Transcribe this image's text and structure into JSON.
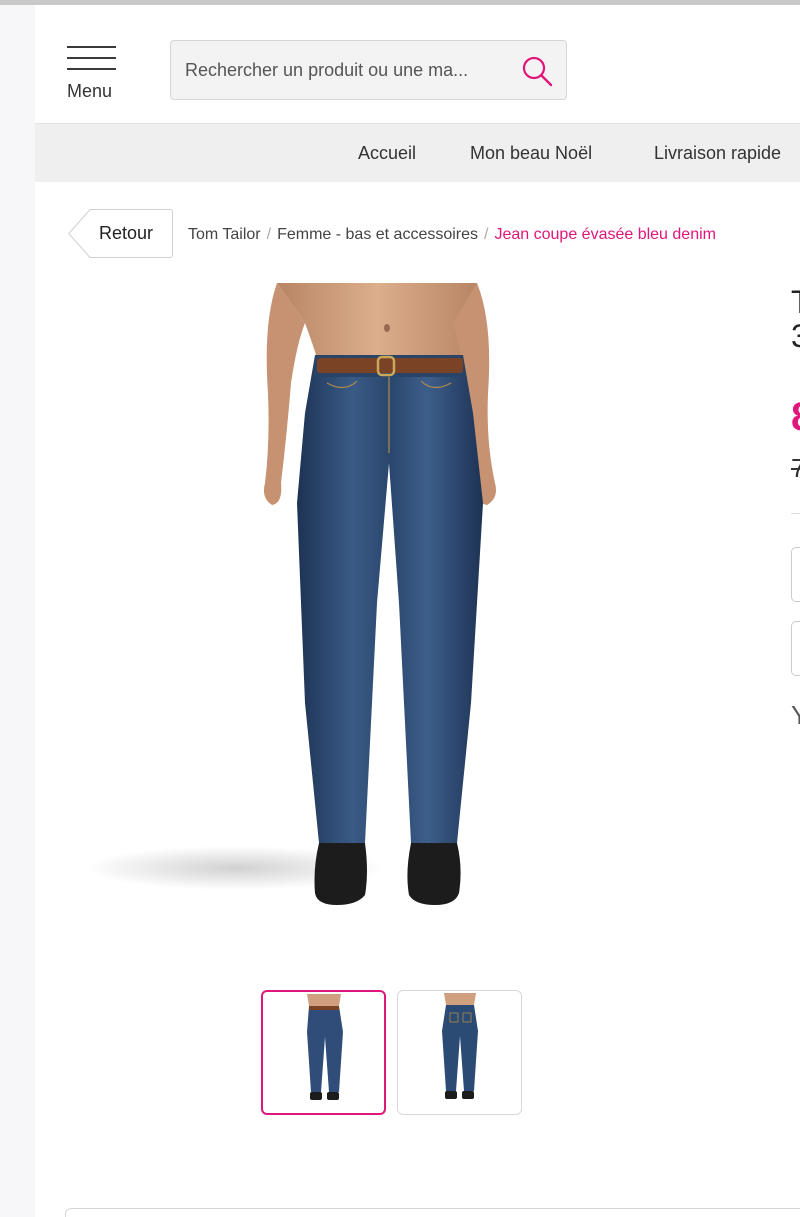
{
  "header": {
    "menu_label": "Menu",
    "search_placeholder": "Rechercher un produit ou une ma..."
  },
  "nav": {
    "items": [
      {
        "label": "Accueil"
      },
      {
        "label": "Mon beau Noël"
      },
      {
        "label": "Livraison rapide"
      }
    ]
  },
  "breadcrumb": {
    "back_label": "Retour",
    "items": [
      {
        "label": "Tom Tailor"
      },
      {
        "label": "Femme - bas et accessoires"
      }
    ],
    "current": "Jean coupe évasée bleu denim"
  },
  "product": {
    "image_icon": "jeans-model-image",
    "thumbnails": [
      {
        "icon": "jeans-front-thumbnail",
        "selected": true
      },
      {
        "icon": "jeans-back-thumbnail",
        "selected": false
      }
    ],
    "title_clipped": "T",
    "title_line2_clipped": "3",
    "price_clipped": "8",
    "old_price_clipped": "7",
    "extra_clipped": "Y"
  },
  "colors": {
    "accent": "#e0167a",
    "nav_bg": "#efeff0"
  }
}
